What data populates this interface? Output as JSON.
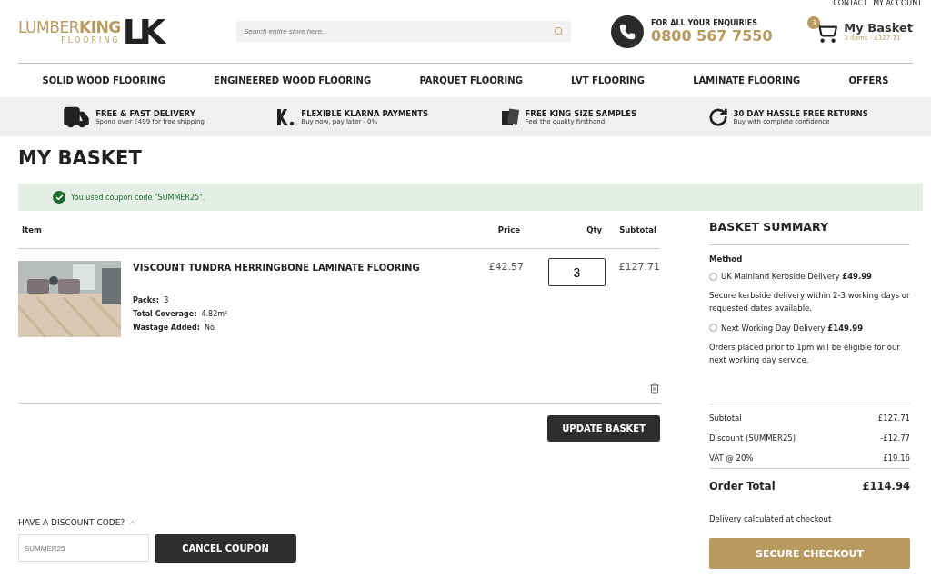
{
  "top_links": [
    "CONTACT",
    "MY ACCOUNT"
  ],
  "logo": {
    "word_light": "LUMBER",
    "word_bold": "KING",
    "tagline": "FLOORING",
    "monogram": "LK"
  },
  "search": {
    "placeholder": "Search entire store here..."
  },
  "phone": {
    "caption": "FOR ALL YOUR ENQUIRIES",
    "number": "0800 567 7550"
  },
  "basket": {
    "count": "3",
    "title": "My Basket",
    "summary": "3 items - £127.71"
  },
  "nav": [
    "SOLID WOOD FLOORING",
    "ENGINEERED WOOD FLOORING",
    "PARQUET FLOORING",
    "LVT FLOORING",
    "LAMINATE FLOORING",
    "OFFERS"
  ],
  "perks": [
    {
      "kind": "truck",
      "title": "FREE & FAST DELIVERY",
      "text": "Spend over £499 for free shipping"
    },
    {
      "kind": "klarna",
      "title": "FLEXIBLE KLARNA PAYMENTS",
      "text": "Buy now, pay later - 0%"
    },
    {
      "kind": "samples",
      "title": "FREE KING SIZE SAMPLES",
      "text": "Feel the quality firsthand"
    },
    {
      "kind": "returns",
      "title": "30 DAY HASSLE FREE RETURNS",
      "text": "Buy with complete confidence"
    }
  ],
  "page_title": "MY BASKET",
  "notice": "You used coupon code \"SUMMER25\".",
  "table": {
    "columns": [
      "Item",
      "Price",
      "Qty",
      "Subtotal"
    ],
    "rows": [
      {
        "name": "VISCOUNT TUNDRA HERRINGBONE LAMINATE FLOORING",
        "price": "£42.57",
        "qty": "3",
        "subtotal": "£127.71",
        "details": [
          {
            "label": "Packs:",
            "value": "3"
          },
          {
            "label": "Total Coverage:",
            "value": "4.82m²"
          },
          {
            "label": "Wastage Added:",
            "value": "No"
          }
        ]
      }
    ]
  },
  "update_button": "UPDATE BASKET",
  "discount": {
    "title": "HAVE A DISCOUNT CODE?",
    "expanded": true,
    "placeholder": "SUMMER25",
    "button": "CANCEL COUPON"
  },
  "summary": {
    "title": "BASKET SUMMARY",
    "method_label": "Method",
    "methods": [
      {
        "label": "UK Mainland Kerbside Delivery",
        "price": "£49.99",
        "selected": false,
        "note": "Secure kerbside delivery within 2-3 working days or requested dates available."
      },
      {
        "label": "Next Working Day Delivery",
        "price": "£149.99",
        "selected": false,
        "note": "Orders placed prior to 1pm will be eligible for our next working day service."
      }
    ],
    "lines": [
      {
        "label": "Subtotal",
        "value": "£127.71"
      },
      {
        "label": "Discount (SUMMER25)",
        "value": "-£12.77"
      },
      {
        "label": "VAT @ 20%",
        "value": "£19.16"
      }
    ],
    "total_label": "Order Total",
    "total_value": "£114.94",
    "note": "Delivery calculated at checkout",
    "checkout": "SECURE CHECKOUT"
  }
}
